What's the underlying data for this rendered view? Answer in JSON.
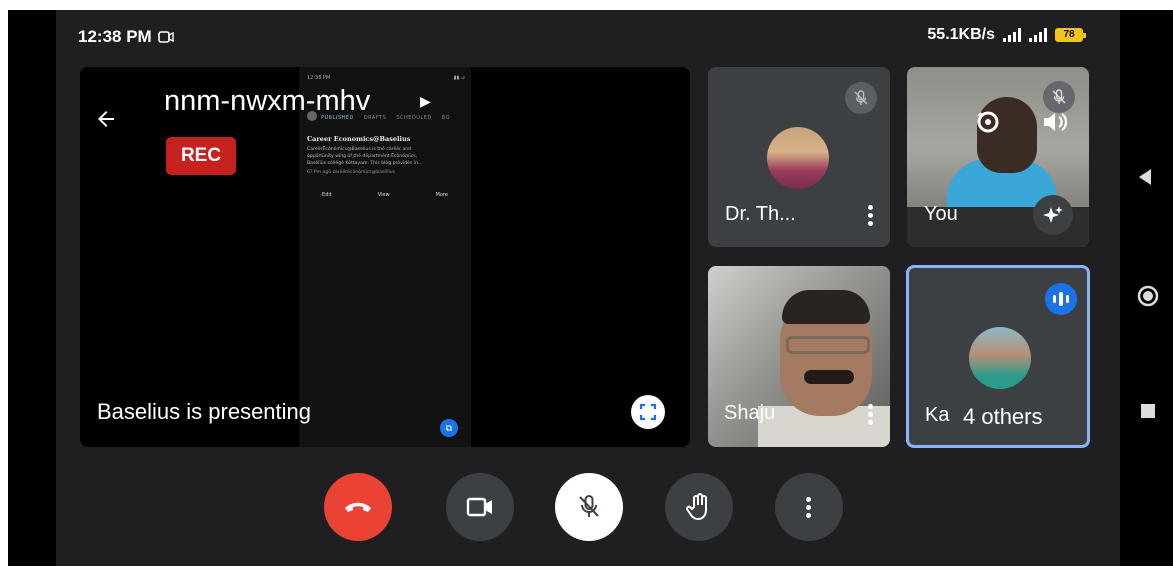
{
  "status_bar": {
    "time": "12:38 PM",
    "network_speed": "55.1KB/s",
    "battery": "78"
  },
  "presentation": {
    "meeting_code": "nnm-nwxm-mhv",
    "rec_label": "REC",
    "presenting_label": "Baselius is presenting",
    "shared_screen": {
      "tabs": [
        "PUBLISHED",
        "DRAFTS",
        "SCHEDULED",
        "BO"
      ],
      "post_title": "Career Economics@Baselius",
      "post_body_1": "CarеërЁcõnõmïcs@Baselius is thë carëër and",
      "post_body_2": "õppõrtünïty wïng õf thë dëpartmënt Ëcõnõmïcs,",
      "post_body_3": "Basëlïüs cõllëgë Kõttayam. This blõg prõvïdës ïn..",
      "post_meta": "6? Pm agõ    carëërëcõnõmïcs@basëlïus",
      "actions": [
        "Edit",
        "View",
        "More"
      ]
    }
  },
  "participants": [
    {
      "name": "Dr. Th...",
      "muted": true
    },
    {
      "name": "You",
      "muted": true
    },
    {
      "name": "Shaju",
      "muted": false
    },
    {
      "name": "Ka",
      "others_label": "4 others",
      "speaking": true
    }
  ],
  "controls": [
    "end-call",
    "camera",
    "microphone-muted",
    "raise-hand",
    "more-options"
  ],
  "colors": {
    "background": "#1f1f21",
    "tile": "#3c4043",
    "end_call": "#ea4335",
    "rec": "#c5221f",
    "active_speaker_border": "#8ab4f8",
    "accent_blue": "#1a73e8"
  }
}
